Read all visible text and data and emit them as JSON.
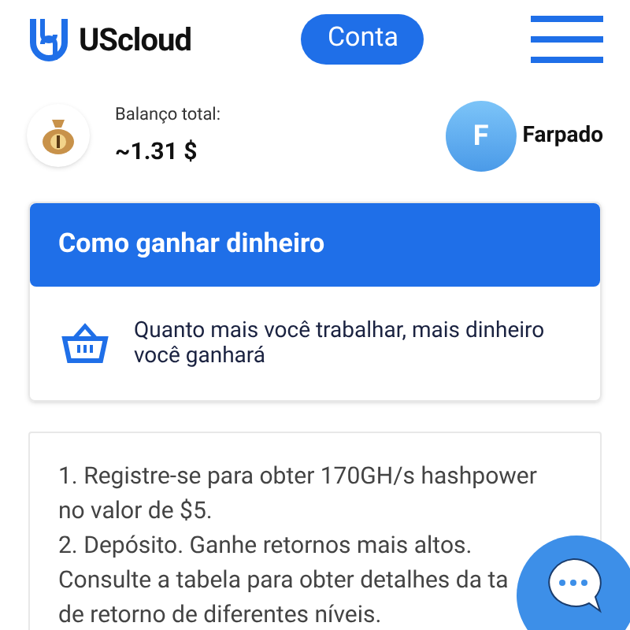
{
  "header": {
    "brand": "UScloud",
    "account_button": "Conta"
  },
  "balance": {
    "label": "Balanço total:",
    "amount": "~1.31 $"
  },
  "user": {
    "initial": "F",
    "name": "Farpado"
  },
  "earn_card": {
    "title": "Como ganhar dinheiro",
    "tip": "Quanto mais você trabalhar, mais dinheiro você ganhará"
  },
  "steps": {
    "lines": [
      "1. Registre-se para obter 170GH/s hashpower",
      "no valor de $5.",
      "2. Depósito. Ganhe retornos mais altos.",
      "Consulte a tabela para obter detalhes da ta",
      "de retorno de diferentes níveis."
    ]
  }
}
